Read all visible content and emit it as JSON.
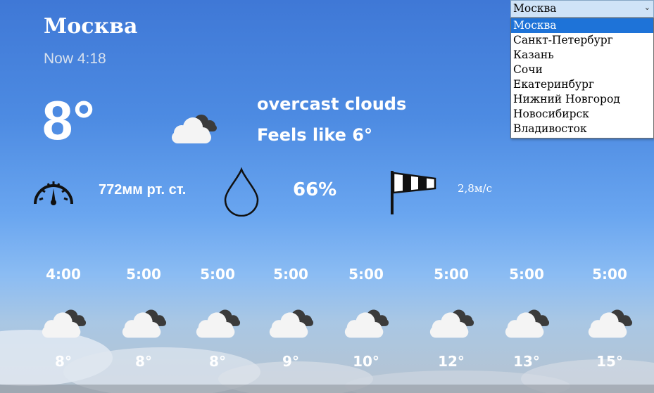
{
  "city": "Москва",
  "now_label": "Now 4:18",
  "current": {
    "temp": "8°",
    "description": "overcast clouds",
    "feels_like": "Feels like 6°",
    "icon": "cloud-icon",
    "pressure": "772мм рт. ст.",
    "humidity": "66%",
    "wind": "2,8м/с"
  },
  "select": {
    "value": "Москва",
    "options": [
      "Москва",
      "Санкт-Петербург",
      "Казань",
      "Сочи",
      "Екатеринбург",
      "Нижний Новгород",
      "Новосибирск",
      "Владивосток"
    ],
    "selected_index": 0
  },
  "forecast": [
    {
      "time": "4:00",
      "temp": "8°"
    },
    {
      "time": "5:00",
      "temp": "8°"
    },
    {
      "time": "5:00",
      "temp": "8°"
    },
    {
      "time": "5:00",
      "temp": "9°"
    },
    {
      "time": "5:00",
      "temp": "10°"
    },
    {
      "time": "5:00",
      "temp": "12°"
    },
    {
      "time": "5:00",
      "temp": "13°"
    },
    {
      "time": "5:00",
      "temp": "15°"
    }
  ],
  "colors": {
    "selected_option": "#1e73d8",
    "select_bg": "#cfe3f7"
  }
}
